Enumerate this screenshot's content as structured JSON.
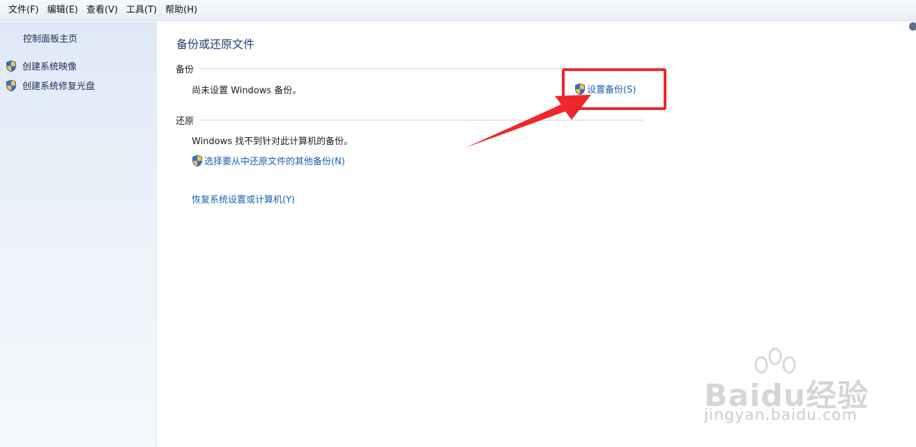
{
  "menubar": {
    "items": [
      "文件(F)",
      "编辑(E)",
      "查看(V)",
      "工具(T)",
      "帮助(H)"
    ]
  },
  "sidebar": {
    "home_label": "控制面板主页",
    "tasks": [
      {
        "label": "创建系统映像",
        "icon": "uac-shield-icon"
      },
      {
        "label": "创建系统修复光盘",
        "icon": "uac-shield-icon"
      }
    ]
  },
  "main": {
    "title": "备份或还原文件",
    "backup": {
      "heading": "备份",
      "status": "尚未设置 Windows 备份。",
      "setup_link": "设置备份(S)"
    },
    "restore": {
      "heading": "还原",
      "status": "Windows 找不到针对此计算机的备份。",
      "other_backup_link": "选择要从中还原文件的其他备份(N)",
      "recover_link": "恢复系统设置或计算机(Y)"
    }
  },
  "annotation": {
    "color": "#f0262a",
    "target": "setup-backup-link"
  },
  "watermark": {
    "brand": "Baidu经验",
    "url": "jingyan.baidu.com"
  },
  "colors": {
    "link": "#1a5fb4",
    "title": "#1e3d73",
    "sidebar_text": "#1b2e55"
  }
}
